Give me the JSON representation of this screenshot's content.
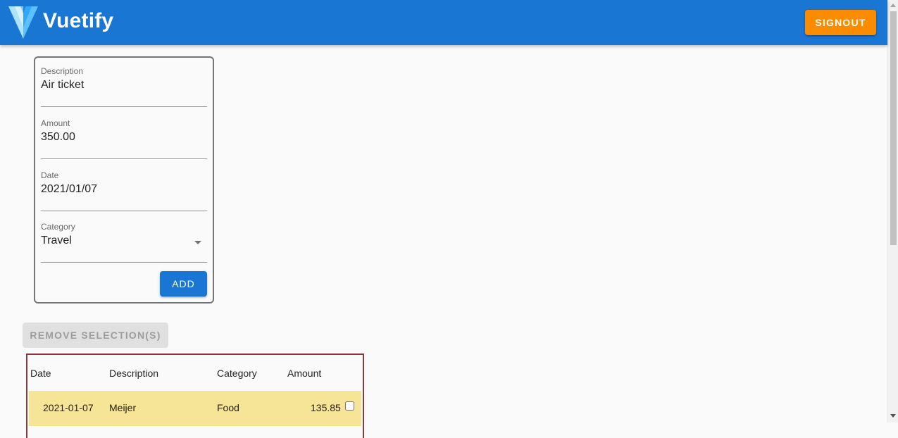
{
  "app": {
    "brand": "Vuetify",
    "logo_icon": "vuetify-logo",
    "signout_label": "SIGNOUT"
  },
  "colors": {
    "appbar": "#1976d2",
    "signout": "#fb8c00",
    "add_button": "#1976d2",
    "selected_row": "#f7e597",
    "table_border": "#8b3a3a"
  },
  "form": {
    "description": {
      "label": "Description",
      "value": "Air ticket"
    },
    "amount": {
      "label": "Amount",
      "value": "350.00"
    },
    "date": {
      "label": "Date",
      "value": "2021/01/07"
    },
    "category": {
      "label": "Category",
      "value": "Travel",
      "icon": "menu-down-icon"
    },
    "add_label": "ADD"
  },
  "actions": {
    "remove_label": "REMOVE SELECTION(S)"
  },
  "table": {
    "headers": [
      "Date",
      "Description",
      "Category",
      "Amount"
    ],
    "rows": [
      {
        "date": "2021-01-07",
        "description": "Meijer",
        "category": "Food",
        "amount": "135.85",
        "checked": false
      }
    ]
  }
}
